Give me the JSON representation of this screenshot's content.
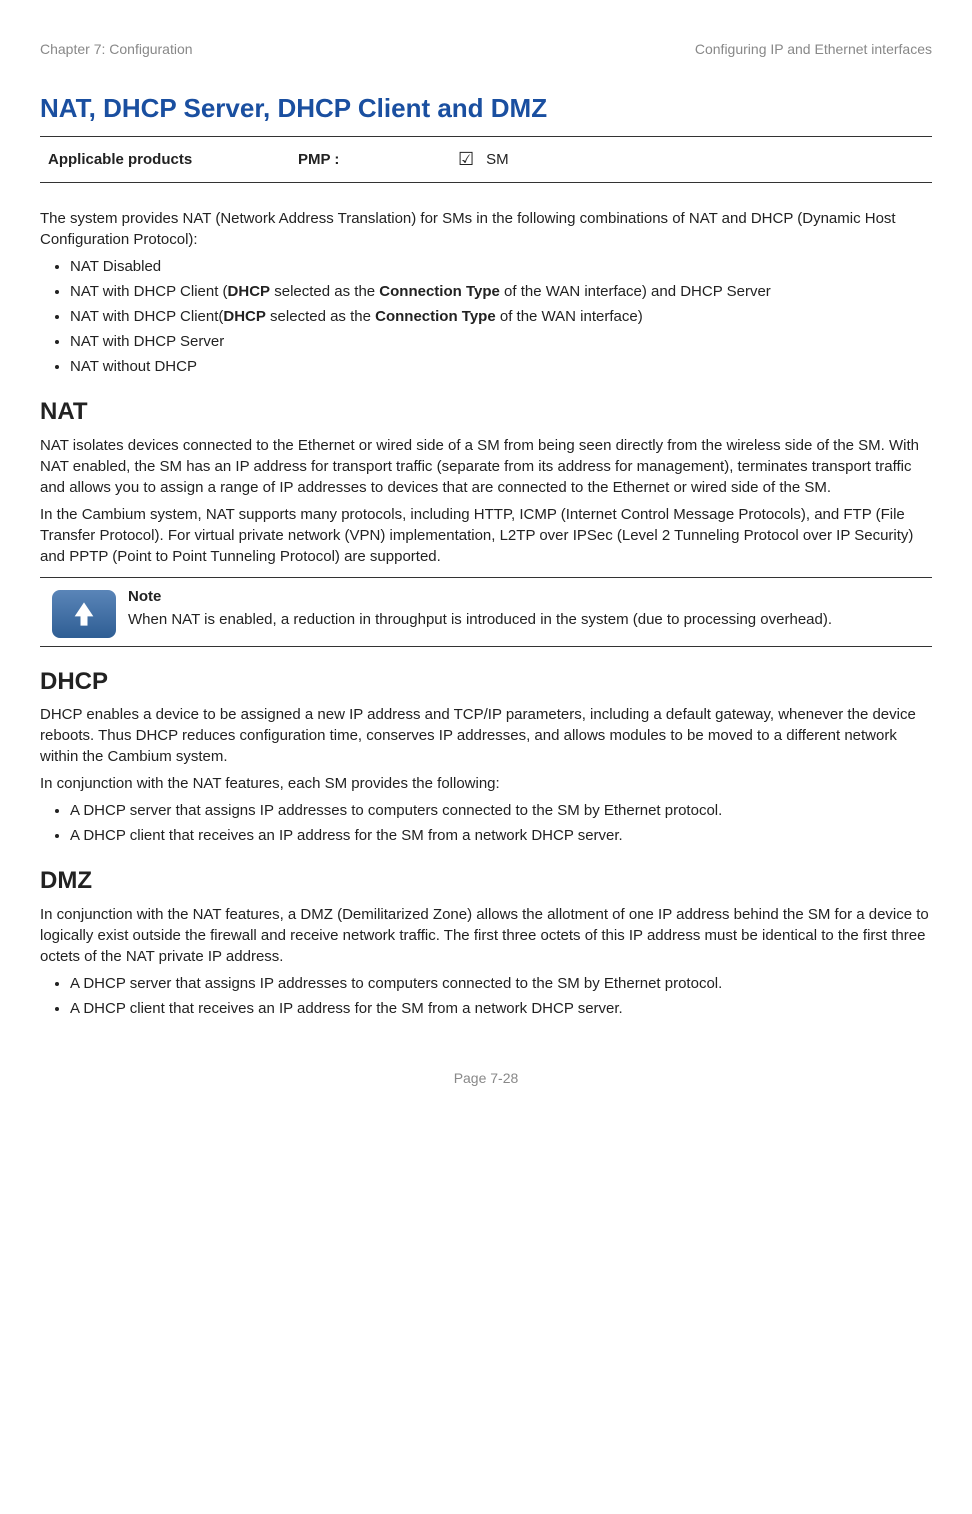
{
  "header": {
    "left": "Chapter 7:  Configuration",
    "right": "Configuring IP and Ethernet interfaces"
  },
  "title": "NAT, DHCP Server, DHCP Client and DMZ",
  "applicable": {
    "label": "Applicable products",
    "pmp": "PMP :",
    "check": "☑",
    "product": "SM"
  },
  "intro": "The system provides NAT (Network Address Translation) for SMs in the following combinations of NAT and DHCP (Dynamic Host Configuration Protocol):",
  "intro_list": [
    {
      "pre": "NAT Disabled"
    },
    {
      "pre": "NAT with DHCP Client (",
      "b1": "DHCP",
      "mid": " selected as the ",
      "b2": "Connection Type",
      "post": " of the WAN interface) and DHCP Server"
    },
    {
      "pre": "NAT with DHCP Client(",
      "b1": "DHCP",
      "mid": " selected as the ",
      "b2": "Connection Type",
      "post": " of the WAN interface)"
    },
    {
      "pre": "NAT with DHCP Server"
    },
    {
      "pre": "NAT without DHCP"
    }
  ],
  "nat": {
    "heading": "NAT",
    "p1": "NAT isolates devices connected to the Ethernet or wired side of a SM from being seen directly from the wireless side of the SM. With NAT enabled, the SM has an IP address for transport traffic (separate from its address for management), terminates transport traffic and allows you to assign a range of IP addresses to devices that are connected to the Ethernet or wired side of the SM.",
    "p2": "In the Cambium system, NAT supports many protocols, including HTTP, ICMP (Internet Control Message Protocols), and FTP (File Transfer Protocol). For virtual private network (VPN) implementation, L2TP over IPSec (Level 2 Tunneling Protocol over IP Security) and PPTP (Point to Point Tunneling Protocol) are supported."
  },
  "note": {
    "label": "Note",
    "text": "When NAT is enabled, a reduction in throughput is introduced in the system (due to processing overhead)."
  },
  "dhcp": {
    "heading": "DHCP",
    "p1": "DHCP enables a device to be assigned a new IP address and TCP/IP parameters, including a default gateway, whenever the device reboots. Thus DHCP reduces configuration time, conserves IP addresses, and allows modules to be moved to a different network within the Cambium system.",
    "p2": "In conjunction with the NAT features, each SM provides the following:",
    "list": [
      "A DHCP server that assigns IP addresses to computers connected to the SM by Ethernet protocol.",
      "A DHCP client that receives an IP address for the SM from a network DHCP server."
    ]
  },
  "dmz": {
    "heading": "DMZ",
    "p1": "In conjunction with the NAT features, a DMZ (Demilitarized Zone) allows the allotment of one IP address behind the SM for a device to logically exist outside the firewall and receive network traffic. The first three octets of this IP address must be identical to the first three octets of the NAT private IP address.",
    "list": [
      "A DHCP server that assigns IP addresses to computers connected to the SM by Ethernet protocol.",
      "A DHCP client that receives an IP address for the SM from a network DHCP server."
    ]
  },
  "footer": "Page 7-28"
}
